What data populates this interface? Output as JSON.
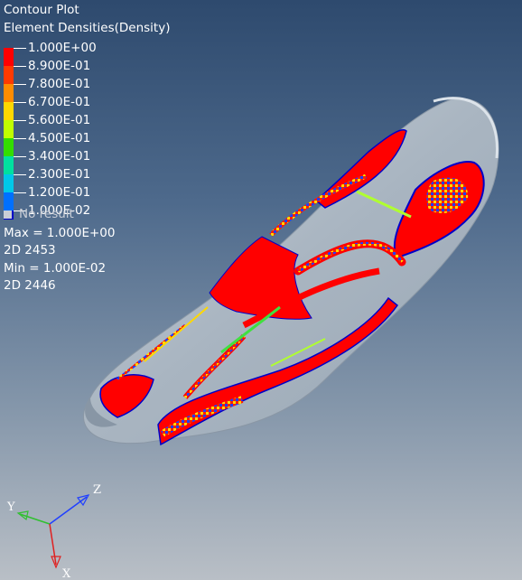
{
  "legend": {
    "title": "Contour Plot",
    "subtitle": "Element Densities(Density)",
    "levels": [
      "1.000E+00",
      "8.900E-01",
      "7.800E-01",
      "6.700E-01",
      "5.600E-01",
      "4.500E-01",
      "3.400E-01",
      "2.300E-01",
      "1.200E-01",
      "1.000E-02"
    ],
    "colors": [
      "#ff0000",
      "#ff3a00",
      "#ff8c00",
      "#ffd800",
      "#c0ff00",
      "#33dd00",
      "#00e0a0",
      "#00c8e8",
      "#0070ff",
      "#0000c8"
    ],
    "no_result": "No result"
  },
  "stats": {
    "max": "Max = 1.000E+00",
    "max_elem": "2D 2453",
    "min": "Min = 1.000E-02",
    "min_elem": "2D 2446"
  },
  "triad": {
    "x": "X",
    "y": "Y",
    "z": "Z"
  },
  "colors": {
    "density_high": "#ff0000",
    "density_low": "#0000c8",
    "surface": "#b7c2cd"
  }
}
